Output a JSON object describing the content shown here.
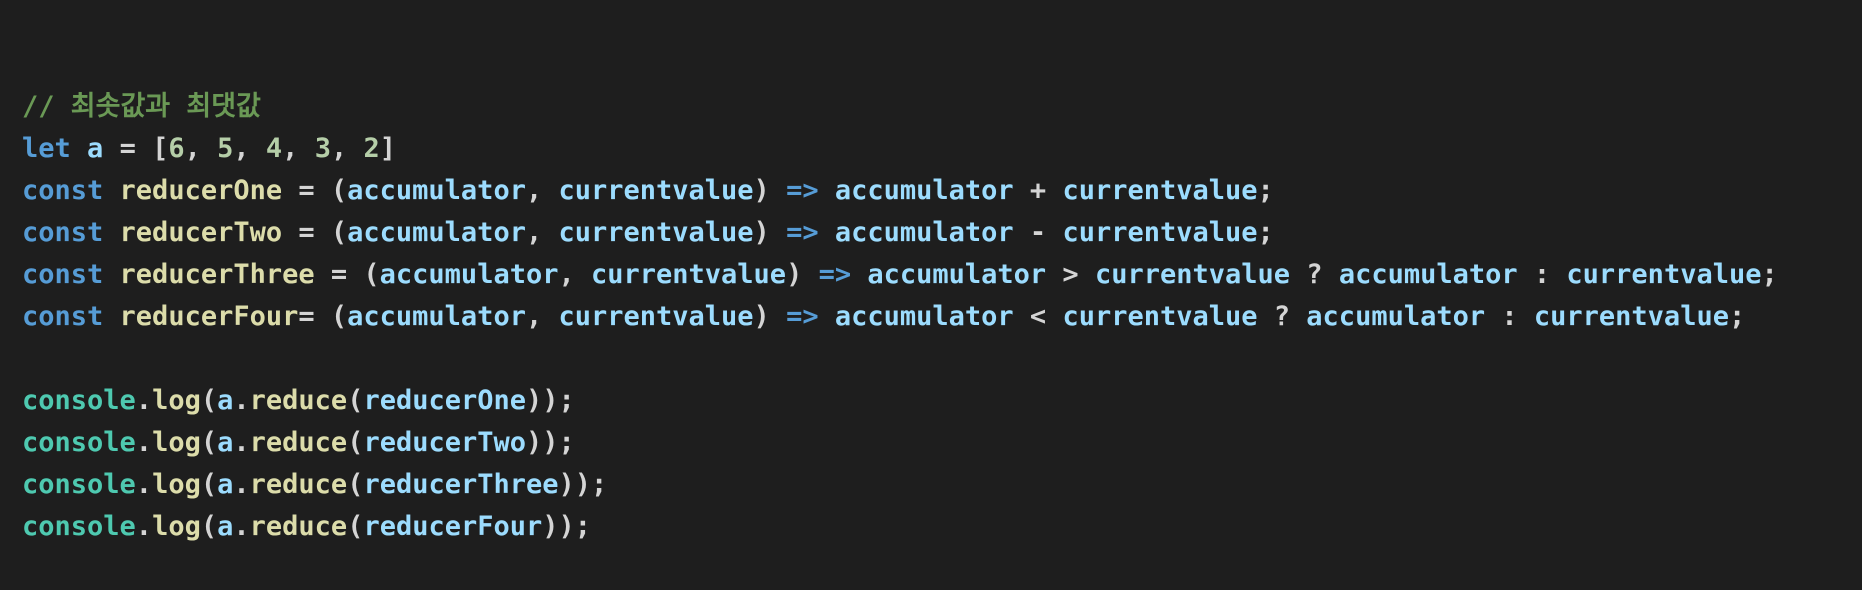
{
  "colors": {
    "background": "#1e1e1e",
    "comment": "#6a9955",
    "keyword": "#569cd6",
    "variable": "#9cdcfe",
    "function": "#dcdcaa",
    "number": "#b5cea8",
    "class": "#4ec9b0",
    "plain": "#d4d4d4"
  },
  "code": {
    "lines": [
      [
        {
          "t": "comment",
          "v": "// 최솟값과 최댓값"
        }
      ],
      [
        {
          "t": "keyword",
          "v": "let"
        },
        {
          "t": "plain",
          "v": " "
        },
        {
          "t": "variable",
          "v": "a"
        },
        {
          "t": "plain",
          "v": " = ["
        },
        {
          "t": "number",
          "v": "6"
        },
        {
          "t": "plain",
          "v": ", "
        },
        {
          "t": "number",
          "v": "5"
        },
        {
          "t": "plain",
          "v": ", "
        },
        {
          "t": "number",
          "v": "4"
        },
        {
          "t": "plain",
          "v": ", "
        },
        {
          "t": "number",
          "v": "3"
        },
        {
          "t": "plain",
          "v": ", "
        },
        {
          "t": "number",
          "v": "2"
        },
        {
          "t": "plain",
          "v": "]"
        }
      ],
      [
        {
          "t": "keyword",
          "v": "const"
        },
        {
          "t": "plain",
          "v": " "
        },
        {
          "t": "function",
          "v": "reducerOne"
        },
        {
          "t": "plain",
          "v": " = ("
        },
        {
          "t": "variable",
          "v": "accumulator"
        },
        {
          "t": "plain",
          "v": ", "
        },
        {
          "t": "variable",
          "v": "currentvalue"
        },
        {
          "t": "plain",
          "v": ") "
        },
        {
          "t": "keyword",
          "v": "=>"
        },
        {
          "t": "plain",
          "v": " "
        },
        {
          "t": "variable",
          "v": "accumulator"
        },
        {
          "t": "plain",
          "v": " + "
        },
        {
          "t": "variable",
          "v": "currentvalue"
        },
        {
          "t": "plain",
          "v": ";"
        }
      ],
      [
        {
          "t": "keyword",
          "v": "const"
        },
        {
          "t": "plain",
          "v": " "
        },
        {
          "t": "function",
          "v": "reducerTwo"
        },
        {
          "t": "plain",
          "v": " = ("
        },
        {
          "t": "variable",
          "v": "accumulator"
        },
        {
          "t": "plain",
          "v": ", "
        },
        {
          "t": "variable",
          "v": "currentvalue"
        },
        {
          "t": "plain",
          "v": ") "
        },
        {
          "t": "keyword",
          "v": "=>"
        },
        {
          "t": "plain",
          "v": " "
        },
        {
          "t": "variable",
          "v": "accumulator"
        },
        {
          "t": "plain",
          "v": " - "
        },
        {
          "t": "variable",
          "v": "currentvalue"
        },
        {
          "t": "plain",
          "v": ";"
        }
      ],
      [
        {
          "t": "keyword",
          "v": "const"
        },
        {
          "t": "plain",
          "v": " "
        },
        {
          "t": "function",
          "v": "reducerThree"
        },
        {
          "t": "plain",
          "v": " = ("
        },
        {
          "t": "variable",
          "v": "accumulator"
        },
        {
          "t": "plain",
          "v": ", "
        },
        {
          "t": "variable",
          "v": "currentvalue"
        },
        {
          "t": "plain",
          "v": ") "
        },
        {
          "t": "keyword",
          "v": "=>"
        },
        {
          "t": "plain",
          "v": " "
        },
        {
          "t": "variable",
          "v": "accumulator"
        },
        {
          "t": "plain",
          "v": " > "
        },
        {
          "t": "variable",
          "v": "currentvalue"
        },
        {
          "t": "plain",
          "v": " ? "
        },
        {
          "t": "variable",
          "v": "accumulator"
        },
        {
          "t": "plain",
          "v": " : "
        },
        {
          "t": "variable",
          "v": "currentvalue"
        },
        {
          "t": "plain",
          "v": ";"
        }
      ],
      [
        {
          "t": "keyword",
          "v": "const"
        },
        {
          "t": "plain",
          "v": " "
        },
        {
          "t": "function",
          "v": "reducerFour"
        },
        {
          "t": "plain",
          "v": "= ("
        },
        {
          "t": "variable",
          "v": "accumulator"
        },
        {
          "t": "plain",
          "v": ", "
        },
        {
          "t": "variable",
          "v": "currentvalue"
        },
        {
          "t": "plain",
          "v": ") "
        },
        {
          "t": "keyword",
          "v": "=>"
        },
        {
          "t": "plain",
          "v": " "
        },
        {
          "t": "variable",
          "v": "accumulator"
        },
        {
          "t": "plain",
          "v": " < "
        },
        {
          "t": "variable",
          "v": "currentvalue"
        },
        {
          "t": "plain",
          "v": " ? "
        },
        {
          "t": "variable",
          "v": "accumulator"
        },
        {
          "t": "plain",
          "v": " : "
        },
        {
          "t": "variable",
          "v": "currentvalue"
        },
        {
          "t": "plain",
          "v": ";"
        }
      ],
      [],
      [
        {
          "t": "class",
          "v": "console"
        },
        {
          "t": "plain",
          "v": "."
        },
        {
          "t": "function",
          "v": "log"
        },
        {
          "t": "plain",
          "v": "("
        },
        {
          "t": "variable",
          "v": "a"
        },
        {
          "t": "plain",
          "v": "."
        },
        {
          "t": "function",
          "v": "reduce"
        },
        {
          "t": "plain",
          "v": "("
        },
        {
          "t": "variable",
          "v": "reducerOne"
        },
        {
          "t": "plain",
          "v": "));"
        }
      ],
      [
        {
          "t": "class",
          "v": "console"
        },
        {
          "t": "plain",
          "v": "."
        },
        {
          "t": "function",
          "v": "log"
        },
        {
          "t": "plain",
          "v": "("
        },
        {
          "t": "variable",
          "v": "a"
        },
        {
          "t": "plain",
          "v": "."
        },
        {
          "t": "function",
          "v": "reduce"
        },
        {
          "t": "plain",
          "v": "("
        },
        {
          "t": "variable",
          "v": "reducerTwo"
        },
        {
          "t": "plain",
          "v": "));"
        }
      ],
      [
        {
          "t": "class",
          "v": "console"
        },
        {
          "t": "plain",
          "v": "."
        },
        {
          "t": "function",
          "v": "log"
        },
        {
          "t": "plain",
          "v": "("
        },
        {
          "t": "variable",
          "v": "a"
        },
        {
          "t": "plain",
          "v": "."
        },
        {
          "t": "function",
          "v": "reduce"
        },
        {
          "t": "plain",
          "v": "("
        },
        {
          "t": "variable",
          "v": "reducerThree"
        },
        {
          "t": "plain",
          "v": "));"
        }
      ],
      [
        {
          "t": "class",
          "v": "console"
        },
        {
          "t": "plain",
          "v": "."
        },
        {
          "t": "function",
          "v": "log"
        },
        {
          "t": "plain",
          "v": "("
        },
        {
          "t": "variable",
          "v": "a"
        },
        {
          "t": "plain",
          "v": "."
        },
        {
          "t": "function",
          "v": "reduce"
        },
        {
          "t": "plain",
          "v": "("
        },
        {
          "t": "variable",
          "v": "reducerFour"
        },
        {
          "t": "plain",
          "v": "));"
        }
      ]
    ]
  }
}
